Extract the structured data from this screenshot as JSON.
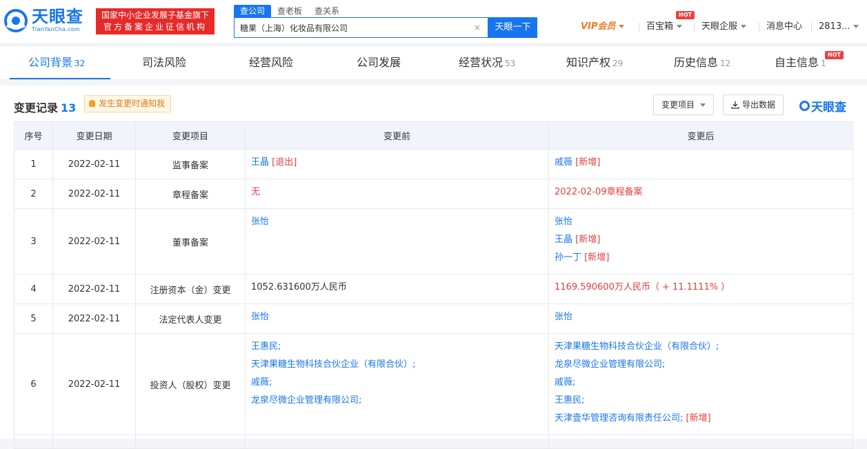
{
  "header": {
    "logo_cn": "天眼查",
    "logo_en": "TianYanCha.com",
    "badge_line1": "国家中小企业发展子基金旗下",
    "badge_line2": "官方备案企业征信机构",
    "search_tabs": [
      "查公司",
      "查老板",
      "查关系"
    ],
    "search_value": "糖果（上海）化妆品有限公司",
    "search_clear": "×",
    "search_button": "天眼一下",
    "vip": "VIP会员",
    "hot": "HOT",
    "treasure": "百宝箱",
    "enterprise": "天眼企服",
    "messages": "消息中心",
    "account": "2813..."
  },
  "tabs": [
    {
      "label": "公司背景",
      "count": "32"
    },
    {
      "label": "司法风险",
      "count": ""
    },
    {
      "label": "经营风险",
      "count": ""
    },
    {
      "label": "公司发展",
      "count": ""
    },
    {
      "label": "经营状况",
      "count": "53"
    },
    {
      "label": "知识产权",
      "count": "29"
    },
    {
      "label": "历史信息",
      "count": "12"
    },
    {
      "label": "自主信息",
      "count": "1"
    }
  ],
  "section": {
    "title": "变更记录",
    "count": "13",
    "notify": "发生变更时通知我",
    "filter_button": "变更项目",
    "export_button": "导出数据",
    "brand": "天眼查"
  },
  "table": {
    "headers": [
      "序号",
      "变更日期",
      "变更项目",
      "变更前",
      "变更后"
    ],
    "rows": [
      {
        "no": "1",
        "date": "2022-02-11",
        "item": "监事备案",
        "before": [
          {
            "text": "王晶",
            "tag": "[退出]"
          }
        ],
        "after": [
          {
            "text": "戚薇",
            "tag": "[新增]"
          }
        ]
      },
      {
        "no": "2",
        "date": "2022-02-11",
        "item": "章程备案",
        "before_red": "无",
        "after_red": "2022-02-09章程备案"
      },
      {
        "no": "3",
        "date": "2022-02-11",
        "item": "董事备案",
        "before": [
          {
            "text": "张怡",
            "tag": ""
          }
        ],
        "after": [
          {
            "text": "张怡",
            "tag": ""
          },
          {
            "text": "王晶",
            "tag": "[新增]"
          },
          {
            "text": "孙一丁",
            "tag": "[新增]"
          }
        ]
      },
      {
        "no": "4",
        "date": "2022-02-11",
        "item": "注册资本（金）变更",
        "before_plain": "1052.631600万人民币",
        "after_red": "1169.590600万人民币（ + 11.1111% ）"
      },
      {
        "no": "5",
        "date": "2022-02-11",
        "item": "法定代表人变更",
        "before": [
          {
            "text": "张怡",
            "tag": ""
          }
        ],
        "after": [
          {
            "text": "张怡",
            "tag": ""
          }
        ]
      },
      {
        "no": "6",
        "date": "2022-02-11",
        "item": "投资人（股权）变更",
        "before": [
          {
            "text": "王惠民;",
            "tag": ""
          },
          {
            "text": "天津果糖生物科技合伙企业（有限合伙）;",
            "tag": ""
          },
          {
            "text": "戚薇;",
            "tag": ""
          },
          {
            "text": "龙泉尽微企业管理有限公司;",
            "tag": ""
          }
        ],
        "after": [
          {
            "text": "天津果糖生物科技合伙企业（有限合伙）;",
            "tag": ""
          },
          {
            "text": "龙泉尽微企业管理有限公司;",
            "tag": ""
          },
          {
            "text": "戚薇;",
            "tag": ""
          },
          {
            "text": "王惠民;",
            "tag": ""
          },
          {
            "text": "天津壹华管理咨询有限责任公司;",
            "tag": "[新增]"
          }
        ]
      }
    ]
  }
}
